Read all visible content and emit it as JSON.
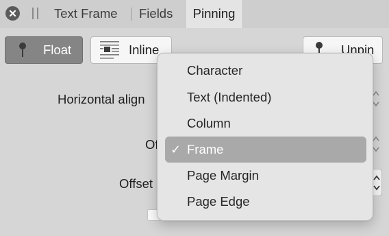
{
  "tabs": {
    "items": [
      {
        "label": "Text Frame"
      },
      {
        "label": "Fields"
      },
      {
        "label": "Pinning"
      }
    ],
    "active": "Pinning"
  },
  "toolbar": {
    "float_label": "Float",
    "inline_label": "Inline",
    "unpin_label": "Unpin"
  },
  "form": {
    "horizontal_alignment_label": "Horizontal align",
    "offset_label_1": "Of",
    "offset_label_2": "Offset"
  },
  "menu": {
    "items": [
      {
        "label": "Character"
      },
      {
        "label": "Text (Indented)"
      },
      {
        "label": "Column"
      },
      {
        "label": "Frame"
      },
      {
        "label": "Page Margin"
      },
      {
        "label": "Page Edge"
      }
    ],
    "selected": "Frame",
    "check_glyph": "✓"
  },
  "colors": {
    "active_button": "#858585",
    "menu_highlight": "#a9a9a9",
    "menu_background": "#e5e5e5"
  }
}
